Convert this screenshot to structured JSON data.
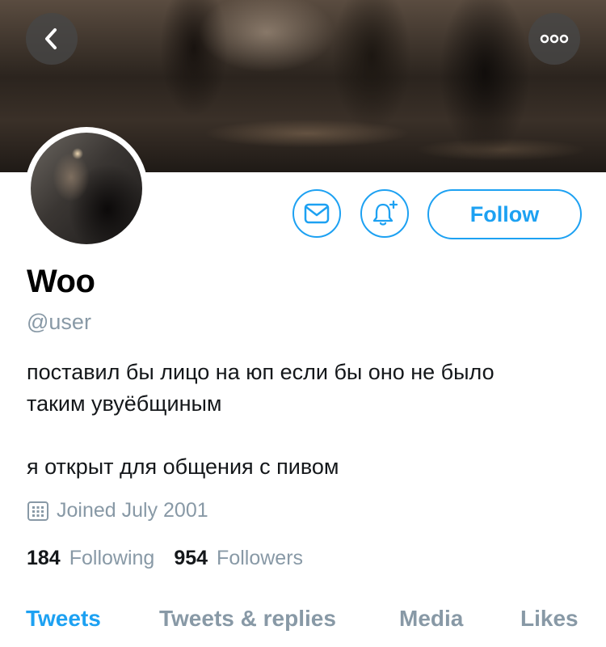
{
  "profile": {
    "display_name": "Woo",
    "handle": "@user",
    "bio_lines": [
      "поставил бы лицо на юп если бы оно не было",
      "таким увуёбщиным",
      "я открыт для общения с пивом"
    ],
    "joined": "Joined July 2001"
  },
  "actions": {
    "follow_label": "Follow",
    "message_icon": "envelope-icon",
    "notify_icon": "bell-plus-icon",
    "back_icon": "chevron-left-icon",
    "more_icon": "more-dots-icon"
  },
  "stats": {
    "following_count": "184",
    "following_label": "Following",
    "followers_count": "954",
    "followers_label": "Followers"
  },
  "tabs": [
    {
      "label": "Tweets",
      "active": true
    },
    {
      "label": "Tweets & replies",
      "active": false
    },
    {
      "label": "Media",
      "active": false
    },
    {
      "label": "Likes",
      "active": false
    }
  ],
  "colors": {
    "accent": "#1da1f2",
    "secondary_text": "#8899a6",
    "primary_text": "#14171a"
  }
}
